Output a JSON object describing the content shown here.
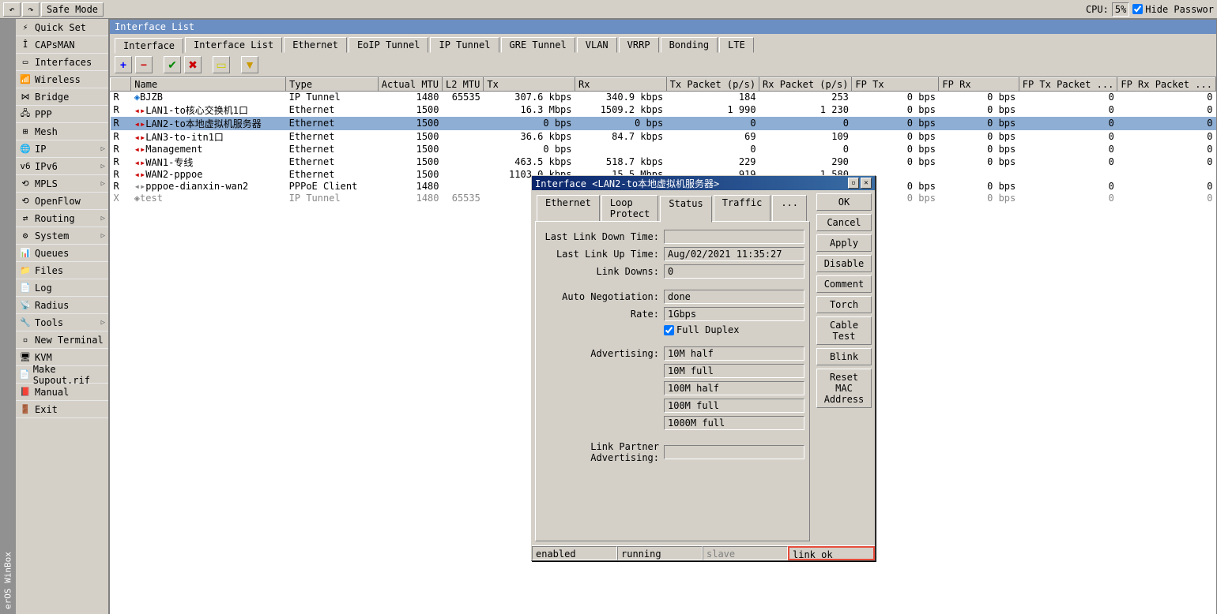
{
  "topbar": {
    "undo_icon": "↶",
    "redo_icon": "↷",
    "safe_mode": "Safe Mode",
    "cpu_label": "CPU:",
    "cpu_value": "5%",
    "hide_passwords": "Hide Passwor"
  },
  "sidebar_title": "erOS WinBox",
  "sidebar": [
    {
      "icon": "⚡",
      "label": "Quick Set",
      "arrow": false
    },
    {
      "icon": "Î",
      "label": "CAPsMAN",
      "arrow": false
    },
    {
      "icon": "▭",
      "label": "Interfaces",
      "arrow": false
    },
    {
      "icon": "📶",
      "label": "Wireless",
      "arrow": false
    },
    {
      "icon": "⋈",
      "label": "Bridge",
      "arrow": false
    },
    {
      "icon": "🖧",
      "label": "PPP",
      "arrow": false
    },
    {
      "icon": "⊞",
      "label": "Mesh",
      "arrow": false
    },
    {
      "icon": "🌐",
      "label": "IP",
      "arrow": true
    },
    {
      "icon": "v6",
      "label": "IPv6",
      "arrow": true
    },
    {
      "icon": "⟲",
      "label": "MPLS",
      "arrow": true
    },
    {
      "icon": "⟲",
      "label": "OpenFlow",
      "arrow": false
    },
    {
      "icon": "⇄",
      "label": "Routing",
      "arrow": true
    },
    {
      "icon": "⚙",
      "label": "System",
      "arrow": true
    },
    {
      "icon": "📊",
      "label": "Queues",
      "arrow": false
    },
    {
      "icon": "📁",
      "label": "Files",
      "arrow": false
    },
    {
      "icon": "📄",
      "label": "Log",
      "arrow": false
    },
    {
      "icon": "📡",
      "label": "Radius",
      "arrow": false
    },
    {
      "icon": "🔧",
      "label": "Tools",
      "arrow": true
    },
    {
      "icon": "▫",
      "label": "New Terminal",
      "arrow": false
    },
    {
      "icon": "🖥",
      "label": "KVM",
      "arrow": false
    },
    {
      "icon": "📄",
      "label": "Make Supout.rif",
      "arrow": false
    },
    {
      "icon": "📕",
      "label": "Manual",
      "arrow": false
    },
    {
      "icon": "🚪",
      "label": "Exit",
      "arrow": false
    }
  ],
  "iface_window": {
    "title": "Interface List",
    "tabs": [
      "Interface",
      "Interface List",
      "Ethernet",
      "EoIP Tunnel",
      "IP Tunnel",
      "GRE Tunnel",
      "VLAN",
      "VRRP",
      "Bonding",
      "LTE"
    ],
    "columns": [
      "",
      "Name",
      "Type",
      "Actual MTU",
      "L2 MTU",
      "Tx",
      "Rx",
      "Tx Packet (p/s)",
      "Rx Packet (p/s)",
      "FP Tx",
      "FP Rx",
      "FP Tx Packet ...",
      "FP Rx Packet ..."
    ],
    "rows": [
      {
        "flag": "R",
        "iclass": "b",
        "ic": "◈",
        "name": "BJZB",
        "type": "IP Tunnel",
        "mtu": "1480",
        "l2": "65535",
        "tx": "307.6 kbps",
        "rx": "340.9 kbps",
        "txp": "184",
        "rxp": "253",
        "fptx": "0 bps",
        "fprx": "0 bps",
        "fptxp": "0",
        "fprxp": "0",
        "sel": false
      },
      {
        "flag": "R",
        "iclass": "r",
        "ic": "◂▸",
        "name": "LAN1-to核心交换机1口",
        "type": "Ethernet",
        "mtu": "1500",
        "l2": "",
        "tx": "16.3 Mbps",
        "rx": "1509.2 kbps",
        "txp": "1 990",
        "rxp": "1 230",
        "fptx": "0 bps",
        "fprx": "0 bps",
        "fptxp": "0",
        "fprxp": "0",
        "sel": false
      },
      {
        "flag": "R",
        "iclass": "r",
        "ic": "◂▸",
        "name": "LAN2-to本地虚拟机服务器",
        "type": "Ethernet",
        "mtu": "1500",
        "l2": "",
        "tx": "0 bps",
        "rx": "0 bps",
        "txp": "0",
        "rxp": "0",
        "fptx": "0 bps",
        "fprx": "0 bps",
        "fptxp": "0",
        "fprxp": "0",
        "sel": true
      },
      {
        "flag": "R",
        "iclass": "r",
        "ic": "◂▸",
        "name": "LAN3-to-itn1口",
        "type": "Ethernet",
        "mtu": "1500",
        "l2": "",
        "tx": "36.6 kbps",
        "rx": "84.7 kbps",
        "txp": "69",
        "rxp": "109",
        "fptx": "0 bps",
        "fprx": "0 bps",
        "fptxp": "0",
        "fprxp": "0",
        "sel": false
      },
      {
        "flag": "R",
        "iclass": "r",
        "ic": "◂▸",
        "name": "Management",
        "type": "Ethernet",
        "mtu": "1500",
        "l2": "",
        "tx": "0 bps",
        "rx": "",
        "txp": "0",
        "rxp": "0",
        "fptx": "0 bps",
        "fprx": "0 bps",
        "fptxp": "0",
        "fprxp": "0",
        "sel": false
      },
      {
        "flag": "R",
        "iclass": "r",
        "ic": "◂▸",
        "name": "WAN1-专线",
        "type": "Ethernet",
        "mtu": "1500",
        "l2": "",
        "tx": "463.5 kbps",
        "rx": "518.7 kbps",
        "txp": "229",
        "rxp": "290",
        "fptx": "0 bps",
        "fprx": "0 bps",
        "fptxp": "0",
        "fprxp": "0",
        "sel": false
      },
      {
        "flag": "R",
        "iclass": "r",
        "ic": "◂▸",
        "name": "WAN2-pppoe",
        "type": "Ethernet",
        "mtu": "1500",
        "l2": "",
        "tx": "1103.0 kbps",
        "rx": "15.5 Mbps",
        "txp": "919",
        "rxp": "1 580",
        "fptx": "",
        "fprx": "",
        "fptxp": "",
        "fprxp": "",
        "sel": false
      },
      {
        "flag": "R",
        "iclass": "g",
        "ic": "◂▸",
        "name": "pppoe-dianxin-wan2",
        "type": "PPPoE Client",
        "mtu": "1480",
        "l2": "",
        "tx": "",
        "rx": "",
        "txp": "",
        "rxp": "",
        "fptx": "0 bps",
        "fprx": "0 bps",
        "fptxp": "0",
        "fprxp": "0",
        "sel": false
      },
      {
        "flag": "X",
        "iclass": "g",
        "ic": "◈",
        "name": "test",
        "type": "IP Tunnel",
        "mtu": "1480",
        "l2": "65535",
        "tx": "",
        "rx": "",
        "txp": "",
        "rxp": "",
        "fptx": "0 bps",
        "fprx": "0 bps",
        "fptxp": "0",
        "fprxp": "0",
        "sel": false
      }
    ]
  },
  "dialog": {
    "title": "Interface <LAN2-to本地虚拟机服务器>",
    "tabs": [
      "Ethernet",
      "Loop Protect",
      "Status",
      "Traffic",
      "..."
    ],
    "buttons": [
      "OK",
      "Cancel",
      "Apply",
      "Disable",
      "Comment",
      "Torch",
      "Cable Test",
      "Blink",
      "Reset MAC Address"
    ],
    "fields": {
      "last_down_label": "Last Link Down Time:",
      "last_down_val": "",
      "last_up_label": "Last Link Up Time:",
      "last_up_val": "Aug/02/2021 11:35:27",
      "link_downs_label": "Link Downs:",
      "link_downs_val": "0",
      "auto_neg_label": "Auto Negotiation:",
      "auto_neg_val": "done",
      "rate_label": "Rate:",
      "rate_val": "1Gbps",
      "full_duplex": "Full Duplex",
      "advertising_label": "Advertising:",
      "adv": [
        "10M half",
        "10M full",
        "100M half",
        "100M full",
        "1000M full"
      ],
      "link_partner_label": "Link Partner Advertising:",
      "link_partner_val": ""
    },
    "status": [
      "enabled",
      "running",
      "slave",
      "link ok"
    ]
  }
}
